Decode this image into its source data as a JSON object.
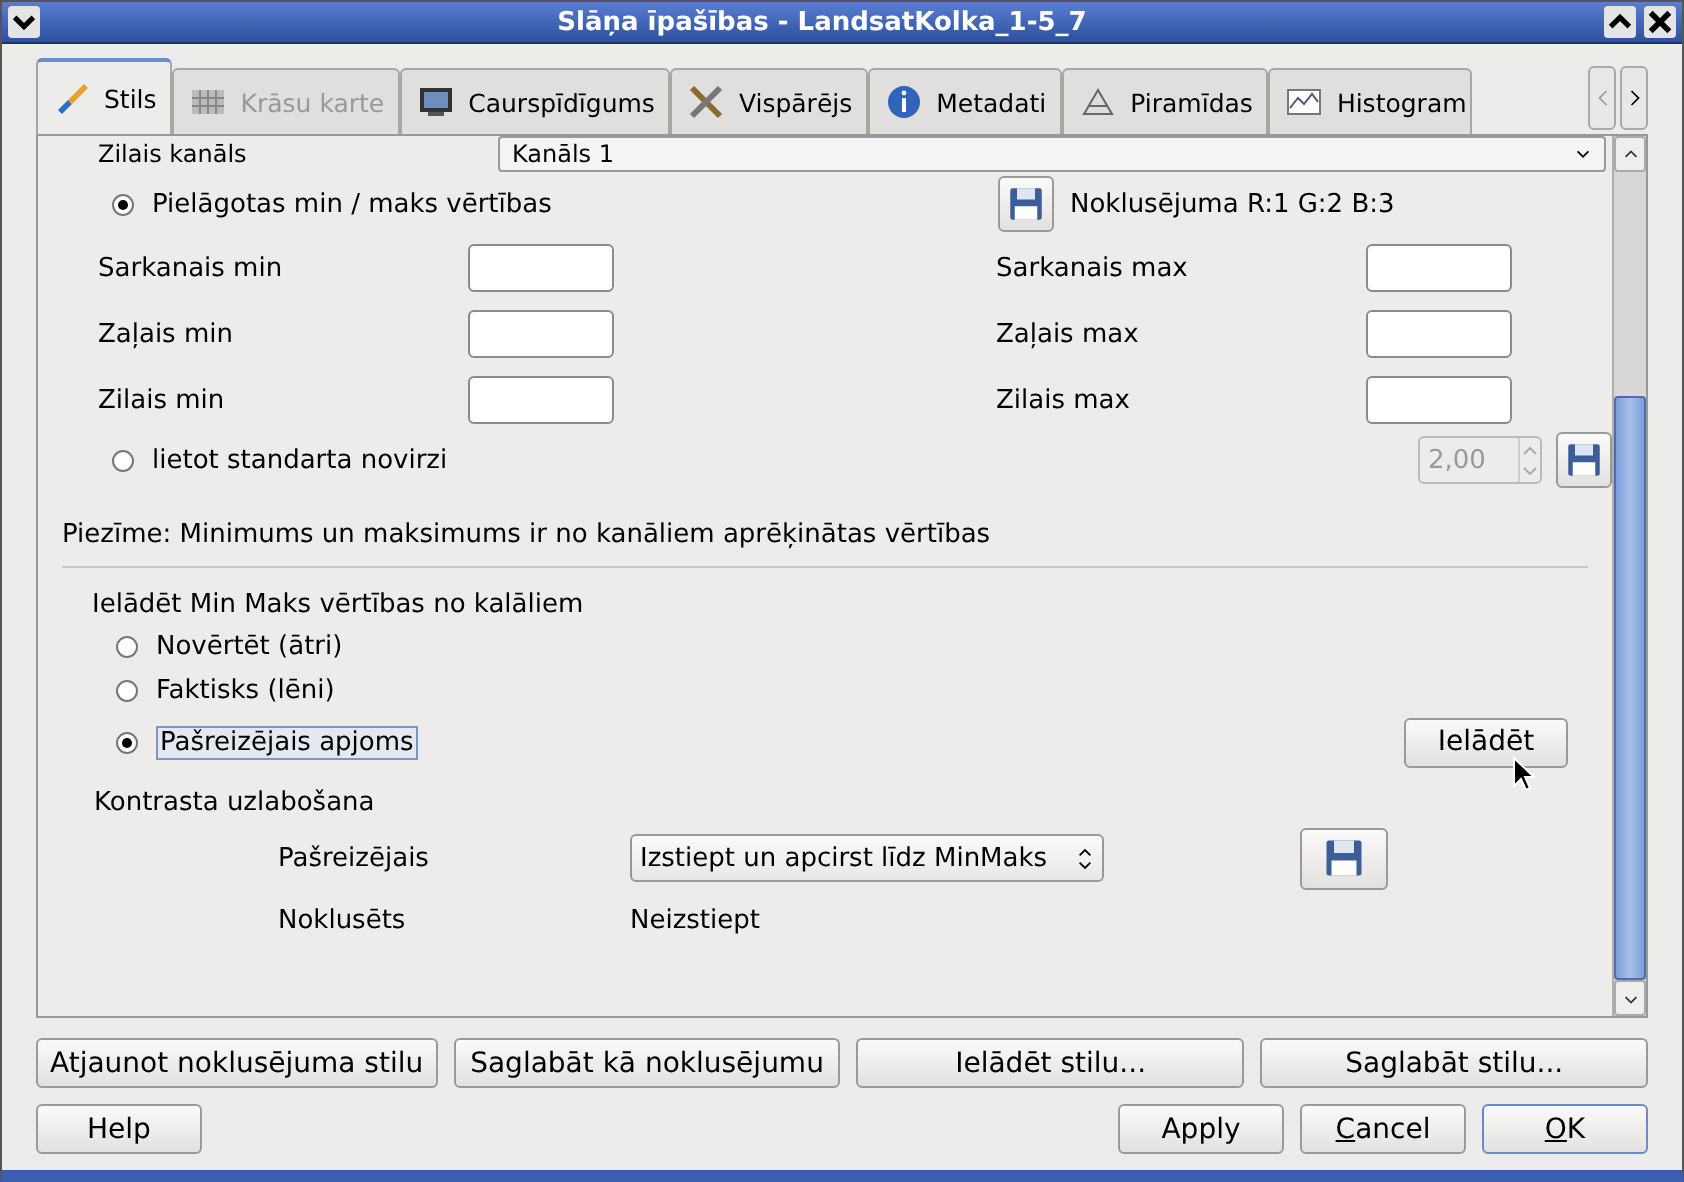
{
  "window": {
    "title": "Slāņa īpašības - LandsatKolka_1-5_7"
  },
  "tabs": [
    {
      "label": "Stils",
      "selected": true,
      "disabled": false
    },
    {
      "label": "Krāsu karte",
      "selected": false,
      "disabled": true
    },
    {
      "label": "Caurspīdīgums",
      "selected": false,
      "disabled": false
    },
    {
      "label": "Vispārējs",
      "selected": false,
      "disabled": false
    },
    {
      "label": "Metadati",
      "selected": false,
      "disabled": false
    },
    {
      "label": "Piramīdas",
      "selected": false,
      "disabled": false
    },
    {
      "label": "Histogram",
      "selected": false,
      "disabled": false
    }
  ],
  "band_row": {
    "label": "Zilais kanāls",
    "value": "Kanāls 1"
  },
  "minmax": {
    "custom_radio": {
      "label": "Pielāgotas min / maks vērtības",
      "selected": true
    },
    "default_label": "Noklusējuma R:1 G:2 B:3",
    "fields": [
      {
        "label": "Sarkanais min"
      },
      {
        "label": "Sarkanais max"
      },
      {
        "label": "Zaļais min"
      },
      {
        "label": "Zaļais max"
      },
      {
        "label": "Zilais min"
      },
      {
        "label": "Zilais max"
      }
    ],
    "stddev_radio": {
      "label": "lietot standarta novirzi",
      "selected": false
    },
    "stddev_value": "2,00"
  },
  "note": "Piezīme: Minimums un maksimums ir no kanāliem aprēķinātas vērtības",
  "load_group": {
    "title": "Ielādēt Min Maks vērtības no kalāliem",
    "options": [
      {
        "label": "Novērtēt (ātri)",
        "selected": false
      },
      {
        "label": "Faktisks (lēni)",
        "selected": false
      },
      {
        "label": "Pašreizējais apjoms",
        "selected": true
      }
    ],
    "button": "Ielādēt"
  },
  "contrast": {
    "title": "Kontrasta uzlabošana",
    "current_label": "Pašreizējais",
    "current_value": "Izstiept un apcirst līdz MinMaks",
    "default_label": "Noklusēts",
    "default_value": "Neizstiept"
  },
  "style_buttons": [
    "Atjaunot noklusējuma stilu",
    "Saglabāt kā noklusējumu",
    "Ielādēt stilu...",
    "Saglabāt stilu..."
  ],
  "dialog_buttons": [
    {
      "label": "Help",
      "mnemonic": false,
      "default": false
    },
    {
      "label": "Apply",
      "mnemonic": false,
      "default": false
    },
    {
      "label": "Cancel",
      "mnemonic": true,
      "default": false
    },
    {
      "label": "OK",
      "mnemonic": true,
      "default": true
    }
  ]
}
